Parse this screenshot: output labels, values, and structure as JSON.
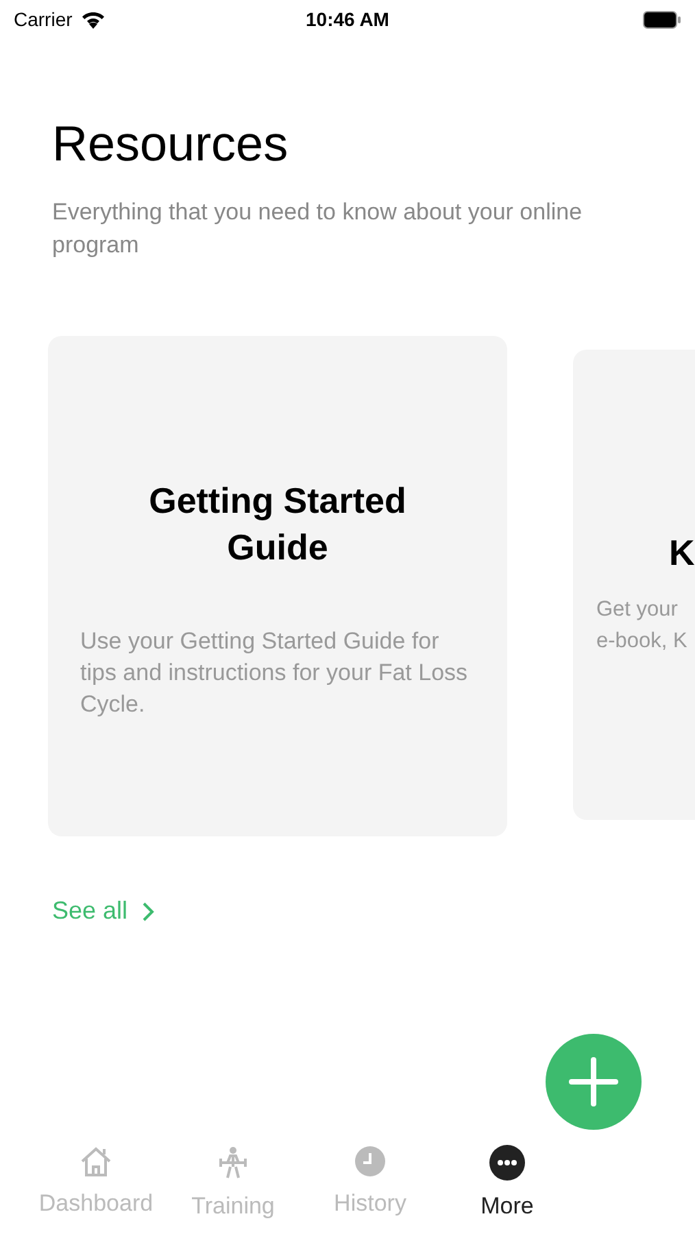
{
  "status_bar": {
    "carrier": "Carrier",
    "time": "10:46 AM"
  },
  "title": "Resources",
  "subtitle": "Everything that you need to know about your online program",
  "cards": [
    {
      "title": "Getting Started Guide",
      "description": "Use your Getting Started Guide for tips and instructions for your Fat Loss Cycle."
    },
    {
      "title": "K",
      "description_lines": [
        "Get your",
        "e-book, K"
      ]
    }
  ],
  "see_all": "See all",
  "tabs": [
    {
      "label": "Dashboard",
      "kind": "home",
      "selected": false
    },
    {
      "label": "Training",
      "kind": "lifter",
      "selected": false
    },
    {
      "label": "History",
      "kind": "clock",
      "selected": false
    },
    {
      "label": "More",
      "kind": "more",
      "selected": true
    }
  ]
}
